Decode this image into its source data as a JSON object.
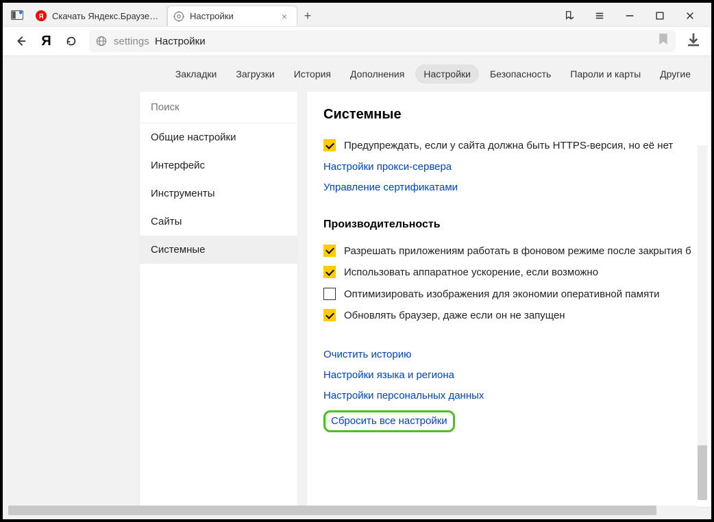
{
  "tabs": [
    {
      "title": "Скачать Яндекс.Браузер д",
      "favicon": "yandex"
    },
    {
      "title": "Настройки",
      "favicon": "gear",
      "active": true
    }
  ],
  "address": {
    "prefix": "settings",
    "title": "Настройки"
  },
  "topnav": {
    "items": [
      "Закладки",
      "Загрузки",
      "История",
      "Дополнения",
      "Настройки",
      "Безопасность",
      "Пароли и карты",
      "Другие"
    ],
    "selected": "Настройки"
  },
  "sidebar": {
    "search_placeholder": "Поиск",
    "items": [
      "Общие настройки",
      "Интерфейс",
      "Инструменты",
      "Сайты",
      "Системные"
    ],
    "active": "Системные"
  },
  "main": {
    "heading": "Системные",
    "https_warn": {
      "checked": true,
      "label": "Предупреждать, если у сайта должна быть HTTPS-версия, но её нет"
    },
    "proxy_link": "Настройки прокси-сервера",
    "cert_link": "Управление сертификатами",
    "perf_heading": "Производительность",
    "perf": [
      {
        "checked": true,
        "label": "Разрешать приложениям работать в фоновом режиме после закрытия б"
      },
      {
        "checked": true,
        "label": "Использовать аппаратное ускорение, если возможно"
      },
      {
        "checked": false,
        "label": "Оптимизировать изображения для экономии оперативной памяти"
      },
      {
        "checked": true,
        "label": "Обновлять браузер, даже если он не запущен"
      }
    ],
    "links": [
      "Очистить историю",
      "Настройки языка и региона",
      "Настройки персональных данных",
      "Сбросить все настройки"
    ],
    "highlight_link_index": 3
  }
}
